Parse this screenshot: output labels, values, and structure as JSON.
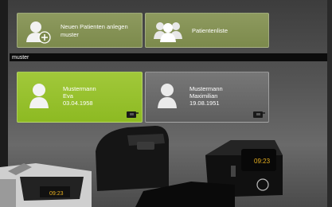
{
  "actions": {
    "new_patient_label": "Neuen Patienten anlegen muster",
    "patient_list_label": "Patientenliste"
  },
  "search": {
    "value": "muster"
  },
  "patients": [
    {
      "lastname": "Mustermann",
      "firstname": "Eva",
      "birthdate": "03.04.1958",
      "selected": true
    },
    {
      "lastname": "Mustermann",
      "firstname": "Maximilian",
      "birthdate": "19.08.1951",
      "selected": false
    }
  ],
  "device_display": {
    "left_value": "09:23",
    "right_value": "09:23"
  },
  "colors": {
    "accent_green": "#8dba22",
    "tile_olive": "#7c8a4c",
    "tile_gray": "#666666",
    "search_bg": "#0c0c0c"
  },
  "icons": [
    "add-patient-icon",
    "patient-list-icon",
    "patient-avatar-icon",
    "device-icon"
  ]
}
